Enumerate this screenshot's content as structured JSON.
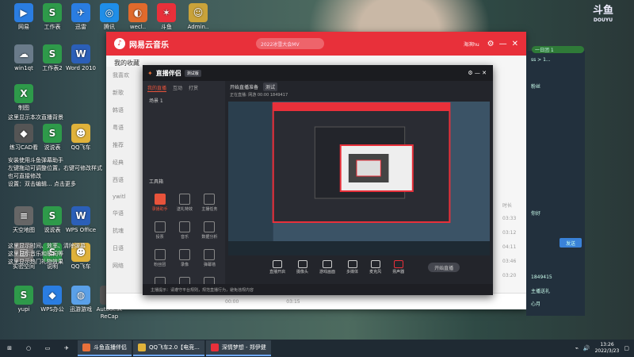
{
  "desktop": {
    "icons": [
      {
        "label": "网易",
        "glyph": "▶",
        "color": "#2a7de1"
      },
      {
        "label": "工作表",
        "glyph": "S",
        "color": "#2e9a4a"
      },
      {
        "label": "迅雷",
        "glyph": "✈",
        "color": "#2a7de1"
      },
      {
        "label": "腾讯",
        "glyph": "◎",
        "color": "#1f8ee8"
      },
      {
        "label": "wecl..",
        "glyph": "◐",
        "color": "#e06a2c"
      },
      {
        "label": "斗鱼",
        "glyph": "✶",
        "color": "#e8303a"
      },
      {
        "label": "Admin..",
        "glyph": "☺",
        "color": "#c9a23a"
      },
      {
        "label": "win1qt",
        "glyph": "☁",
        "color": "#6a7b8a"
      },
      {
        "label": "工作表2",
        "glyph": "S",
        "color": "#2e9a4a"
      },
      {
        "label": "Word 2010",
        "glyph": "W",
        "color": "#2b5fb8"
      },
      {
        "label": "制图",
        "glyph": "X",
        "color": "#2e9a4a"
      },
      {
        "label": "练习CAD看",
        "glyph": "◆",
        "color": "#555"
      },
      {
        "label": "说说表",
        "glyph": "S",
        "color": "#2e9a4a"
      },
      {
        "label": "QQ飞车",
        "glyph": "☻",
        "color": "#e0b23a"
      },
      {
        "label": "天空地图",
        "glyph": "≡",
        "color": "#666"
      },
      {
        "label": "说说表",
        "glyph": "S",
        "color": "#2e9a4a"
      },
      {
        "label": "WPS Office",
        "glyph": "W",
        "color": "#2b5fb8"
      },
      {
        "label": "实验空间",
        "glyph": "▤",
        "color": "#777"
      },
      {
        "label": "说明",
        "glyph": "S",
        "color": "#2e9a4a"
      },
      {
        "label": "QQ飞车",
        "glyph": "☻",
        "color": "#e0b23a"
      },
      {
        "label": "yupi",
        "glyph": "S",
        "color": "#2e9a4a"
      },
      {
        "label": "WPS办公",
        "glyph": "◆",
        "color": "#2a7de1"
      },
      {
        "label": "迅游游戏",
        "glyph": "◍",
        "color": "#5aa0e8"
      },
      {
        "label": "Autodesk ReCap",
        "glyph": "⏴",
        "color": "#555"
      }
    ],
    "notes": [
      "这里显示本次直播背景",
      "安装使用斗鱼弹幕助手",
      "左键拖动可调整位置，右键可修改样式",
      "也可直接修改",
      "设置：双击编辑... 点击更多",
      "这里显示时间、效率、清除弹幕",
      "这里显示音乐和歌词等",
      "这里显示热门礼物效果"
    ]
  },
  "music_app": {
    "name": "网易云音乐",
    "search_placeholder": "2022冰雪大会MV",
    "user": "海滨hu",
    "favorite": "我的收藏",
    "sidebar": [
      "我喜欢",
      "新歌",
      "韩语",
      "粤语",
      "推荐",
      "经典",
      "西语",
      "ywitl",
      "华语",
      "抗魂",
      "日语",
      "网络"
    ],
    "times": [
      "时长",
      "03:33",
      "03:12",
      "04:11",
      "03:46",
      "03:20"
    ],
    "footer": [
      "00:00",
      "03:15"
    ],
    "more": "更多"
  },
  "companion": {
    "title": "直播伴侣",
    "version": "测试版",
    "tabs": [
      "我的直播",
      "互动",
      "打赏"
    ],
    "scene": "场景 1",
    "stream_title": "开始直播准备",
    "stream_tag": "测试",
    "sub": "正在直播: 网游   00:00  1849417",
    "tools_title": "工具箱",
    "tools": [
      "录播助手",
      "送礼特效",
      "主播任务",
      "投票",
      "音乐",
      "数据分析",
      "粉丝团",
      "录像",
      "弹幕墙",
      "道具",
      "剧场",
      "更多"
    ],
    "controls": [
      "直播开启",
      "摄像头",
      "游戏画面",
      "多媒体",
      "麦克风"
    ],
    "mic_label": "扬声器",
    "start": "开始直播",
    "notice": "主播提示：请遵守平台规则，规范直播行为，避免违规内容"
  },
  "chat": {
    "badge": "一日团 1",
    "send": "发送",
    "lines": [
      "ss > 1...",
      "粉丝",
      "你好",
      "1849415",
      "主播送礼",
      "心月"
    ]
  },
  "site_logo": {
    "line1": "斗鱼",
    "line2": "DOUYU"
  },
  "taskbar": {
    "apps": [
      {
        "label": "斗鱼直播伴侣",
        "color": "#e8703a"
      },
      {
        "label": "QQ飞车2.0【电竞...",
        "color": "#e0b23a"
      },
      {
        "label": "深情梦想 - 郑伊健",
        "color": "#e8303a"
      }
    ],
    "time": "13:26",
    "date": "2022/3/23"
  }
}
